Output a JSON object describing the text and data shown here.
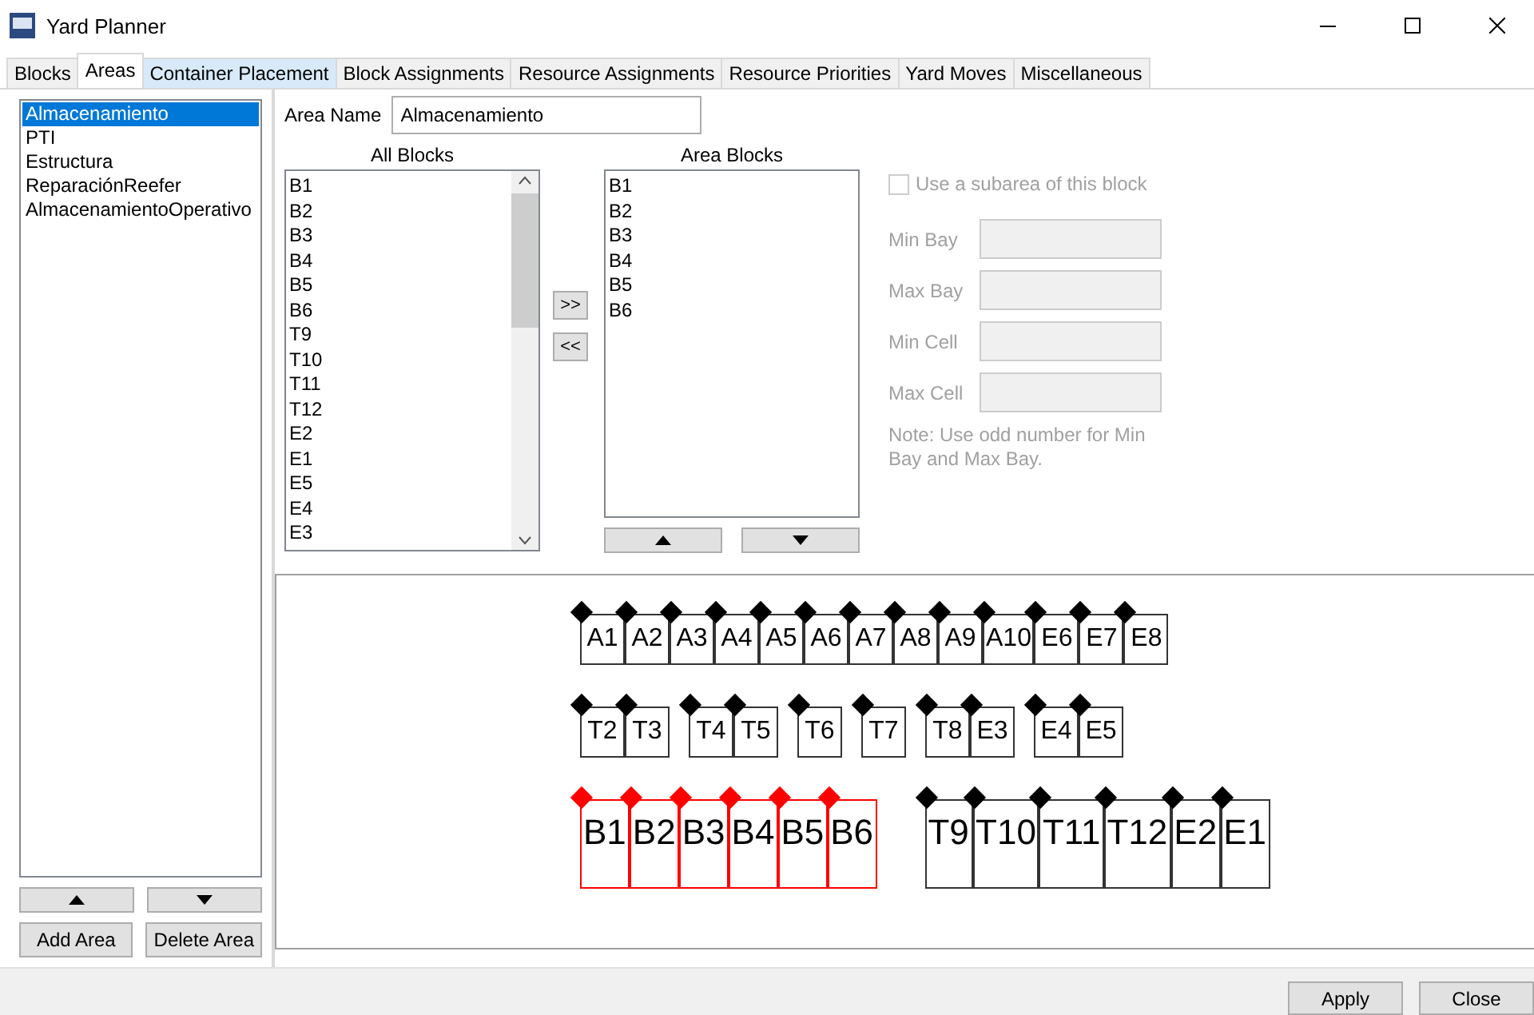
{
  "window": {
    "title": "Yard Planner"
  },
  "tabs": [
    {
      "label": "Blocks",
      "selected": false,
      "hovered": false
    },
    {
      "label": "Areas",
      "selected": true,
      "hovered": false
    },
    {
      "label": "Container Placement",
      "selected": false,
      "hovered": true
    },
    {
      "label": "Block Assignments",
      "selected": false,
      "hovered": false
    },
    {
      "label": "Resource Assignments",
      "selected": false,
      "hovered": false
    },
    {
      "label": "Resource Priorities",
      "selected": false,
      "hovered": false
    },
    {
      "label": "Yard Moves",
      "selected": false,
      "hovered": false
    },
    {
      "label": "Miscellaneous",
      "selected": false,
      "hovered": false
    }
  ],
  "areas": {
    "items": [
      {
        "label": "Almacenamiento",
        "selected": true
      },
      {
        "label": "PTI",
        "selected": false
      },
      {
        "label": "Estructura",
        "selected": false
      },
      {
        "label": "ReparaciónReefer",
        "selected": false
      },
      {
        "label": "AlmacenamientoOperativo",
        "selected": false
      }
    ],
    "add_button": "Add Area",
    "delete_button": "Delete Area"
  },
  "area_name": {
    "label": "Area Name",
    "value": "Almacenamiento"
  },
  "all_blocks": {
    "title": "All Blocks",
    "items": [
      "B1",
      "B2",
      "B3",
      "B4",
      "B5",
      "B6",
      "T9",
      "T10",
      "T11",
      "T12",
      "E2",
      "E1",
      "E5",
      "E4",
      "E3"
    ]
  },
  "transfer_buttons": [
    ">>",
    "<<"
  ],
  "area_blocks": {
    "title": "Area Blocks",
    "items": [
      "B1",
      "B2",
      "B3",
      "B4",
      "B5",
      "B6"
    ]
  },
  "subarea": {
    "checkbox_label": "Use a subarea of this block",
    "checked": false,
    "disabled": true,
    "fields": [
      {
        "label": "Min Bay"
      },
      {
        "label": "Max Bay"
      },
      {
        "label": "Min Cell"
      },
      {
        "label": "Max Cell"
      }
    ],
    "note": "Note: Use odd number for Min Bay and Max Bay."
  },
  "yard_map": {
    "rows": [
      {
        "kind": "standard",
        "groups": [
          [
            {
              "label": "A1",
              "in_area": false
            },
            {
              "label": "A2",
              "in_area": false
            },
            {
              "label": "A3",
              "in_area": false
            },
            {
              "label": "A4",
              "in_area": false
            },
            {
              "label": "A5",
              "in_area": false
            },
            {
              "label": "A6",
              "in_area": false
            },
            {
              "label": "A7",
              "in_area": false
            },
            {
              "label": "A8",
              "in_area": false
            },
            {
              "label": "A9",
              "in_area": false
            },
            {
              "label": "A10",
              "in_area": false
            },
            {
              "label": "E6",
              "in_area": false
            },
            {
              "label": "E7",
              "in_area": false
            },
            {
              "label": "E8",
              "in_area": false
            }
          ]
        ]
      },
      {
        "kind": "standard",
        "groups": [
          [
            {
              "label": "T2",
              "in_area": false
            },
            {
              "label": "T3",
              "in_area": false
            }
          ],
          [
            {
              "label": "T4",
              "in_area": false
            },
            {
              "label": "T5",
              "in_area": false
            }
          ],
          [
            {
              "label": "T6",
              "in_area": false
            }
          ],
          [
            {
              "label": "T7",
              "in_area": false
            }
          ],
          [
            {
              "label": "T8",
              "in_area": false
            },
            {
              "label": "E3",
              "in_area": false
            }
          ],
          [
            {
              "label": "E4",
              "in_area": false
            },
            {
              "label": "E5",
              "in_area": false
            }
          ]
        ]
      },
      {
        "kind": "large",
        "groups": [
          [
            {
              "label": "B1",
              "in_area": true
            },
            {
              "label": "B2",
              "in_area": true
            },
            {
              "label": "B3",
              "in_area": true
            },
            {
              "label": "B4",
              "in_area": true
            },
            {
              "label": "B5",
              "in_area": true
            },
            {
              "label": "B6",
              "in_area": true
            }
          ],
          [
            {
              "label": "T9",
              "in_area": false
            },
            {
              "label": "T10",
              "in_area": false
            },
            {
              "label": "T11",
              "in_area": false
            },
            {
              "label": "T12",
              "in_area": false
            },
            {
              "label": "E2",
              "in_area": false
            },
            {
              "label": "E1",
              "in_area": false
            }
          ]
        ]
      }
    ]
  },
  "footer_buttons": [
    "Apply",
    "Close"
  ]
}
